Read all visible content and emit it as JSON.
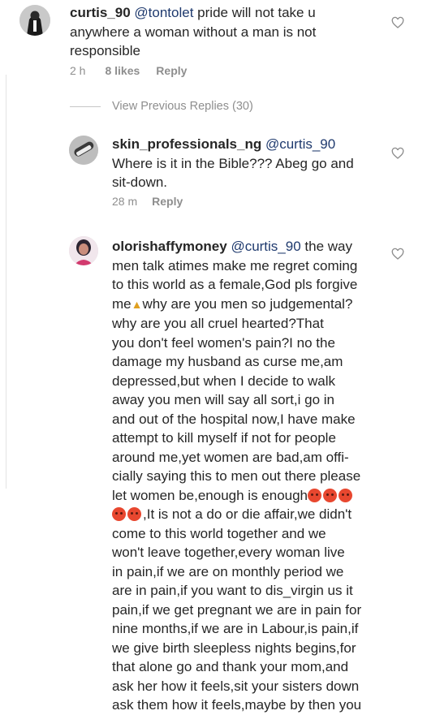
{
  "comments": [
    {
      "username": "curtis_90",
      "mention": "@tontolet",
      "lines": [
        "pride will not take u",
        "anywhere a woman without a man is not",
        "responsible"
      ],
      "time": "2 h",
      "likes": "8 likes",
      "reply": "Reply"
    },
    {
      "username": "skin_professionals_ng",
      "mention": "@curtis_90",
      "lines": [
        "Where is it in the Bible??? Abeg go and",
        "sit-down."
      ],
      "time": "28 m",
      "reply": "Reply"
    },
    {
      "username": "olorishaffymoney",
      "mention": "@curtis_90",
      "first_line_tail": "the way",
      "lines": [
        "men talk atimes make me regret coming",
        "to this world as a female,God pls forgive",
        "me",
        "why are you men so judgemental?",
        "why are you all cruel hearted?That",
        "you don't feel women's pain?I no the",
        "damage my husband as curse me,am",
        "depressed,but when I decide to walk",
        "away you men will say all sort,i go in",
        "and out of the hospital now,I have make",
        "attempt to kill myself if not for people",
        "around me,yet women are bad,am offi-",
        "cially saying this to men out there please",
        "let women be,enough is enough",
        ",It is not a do or die affair,we didn't",
        "come to this world together and we",
        "won't leave together,every woman live",
        "in pain,if we are on monthly period we",
        "are in pain,if you want to dis_virgin us it",
        "pain,if we get pregnant we are in pain for",
        "nine months,if we are in Labour,is pain,if",
        "we give birth sleepless nights begins,for",
        "that alone go and thank your mom,and",
        "ask her how it feels,sit your sisters down",
        "ask them how it feels,maybe by then you"
      ]
    }
  ],
  "view_previous": "View Previous Replies (30)",
  "icons": {
    "like": "heart-outline-icon"
  }
}
